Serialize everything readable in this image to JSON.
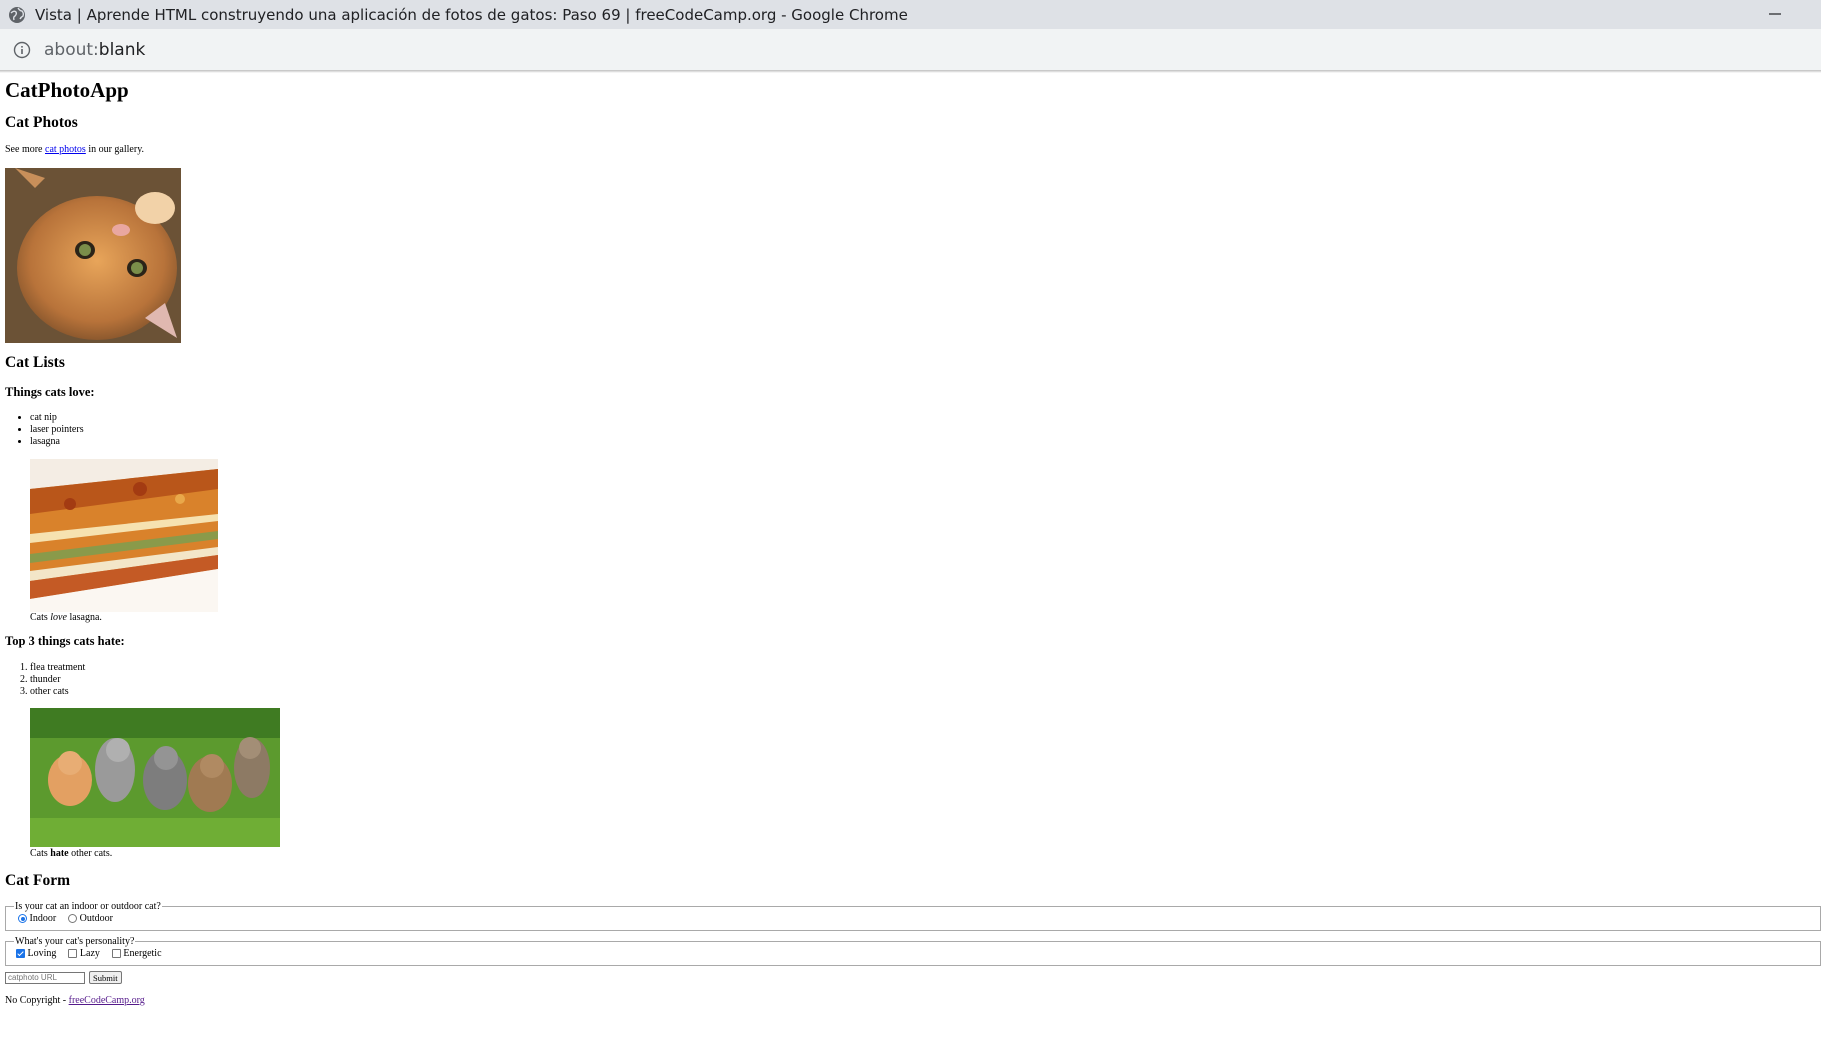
{
  "window": {
    "title": "Vista | Aprende HTML construyendo una aplicación de fotos de gatos: Paso 69 | freeCodeCamp.org - Google Chrome",
    "minimize_glyph": "—"
  },
  "address_bar": {
    "url_scheme": "about:",
    "url_rest": "blank"
  },
  "page": {
    "h1": "CatPhotoApp",
    "section_photos": {
      "heading": "Cat Photos",
      "text_before": "See more ",
      "link": "cat photos",
      "text_after": " in our gallery."
    },
    "section_lists": {
      "heading": "Cat Lists",
      "love_heading": "Things cats love:",
      "love_items": [
        "cat nip",
        "laser pointers",
        "lasagna"
      ],
      "love_caption_before": "Cats ",
      "love_caption_em": "love",
      "love_caption_after": " lasagna.",
      "hate_heading": "Top 3 things cats hate:",
      "hate_items": [
        "flea treatment",
        "thunder",
        "other cats"
      ],
      "hate_caption_before": "Cats ",
      "hate_caption_strong": "hate",
      "hate_caption_after": " other cats."
    },
    "section_form": {
      "heading": "Cat Form",
      "fieldset_indoor": {
        "legend": "Is your cat an indoor or outdoor cat?",
        "options": [
          "Indoor",
          "Outdoor"
        ],
        "selected": "Indoor"
      },
      "fieldset_personality": {
        "legend": "What's your cat's personality?",
        "options": [
          "Loving",
          "Lazy",
          "Energetic"
        ],
        "checked": [
          "Loving"
        ]
      },
      "url_placeholder": "catphoto URL",
      "submit_label": "Submit"
    },
    "footer": {
      "text": "No Copyright - ",
      "link": "freeCodeCamp.org"
    }
  },
  "colors": {
    "link": "#0000ee",
    "visited_link": "#551a8b",
    "accent": "#1a73e8",
    "titlebar_bg": "#dee1e6",
    "addressbar_bg": "#f1f3f4"
  }
}
